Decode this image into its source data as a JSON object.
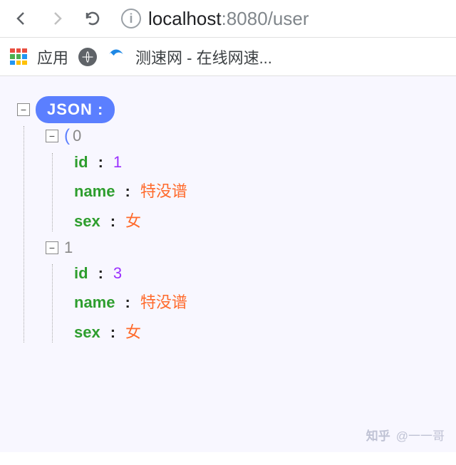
{
  "toolbar": {
    "url_host": "localhost",
    "url_port": ":8080",
    "url_path": "/user"
  },
  "bookmarks": {
    "apps_label": "应用",
    "speed_label": "测速网 - 在线网速..."
  },
  "json_view": {
    "badge": "JSON :",
    "items": [
      {
        "index": "0",
        "props": [
          {
            "key": "id",
            "value": "1",
            "type": "num"
          },
          {
            "key": "name",
            "value": "特没谱",
            "type": "str"
          },
          {
            "key": "sex",
            "value": "女",
            "type": "str"
          }
        ]
      },
      {
        "index": "1",
        "props": [
          {
            "key": "id",
            "value": "3",
            "type": "num"
          },
          {
            "key": "name",
            "value": "特没谱",
            "type": "str"
          },
          {
            "key": "sex",
            "value": "女",
            "type": "str"
          }
        ]
      }
    ]
  },
  "watermark": {
    "text": "@一一哥",
    "logo": "知乎"
  }
}
